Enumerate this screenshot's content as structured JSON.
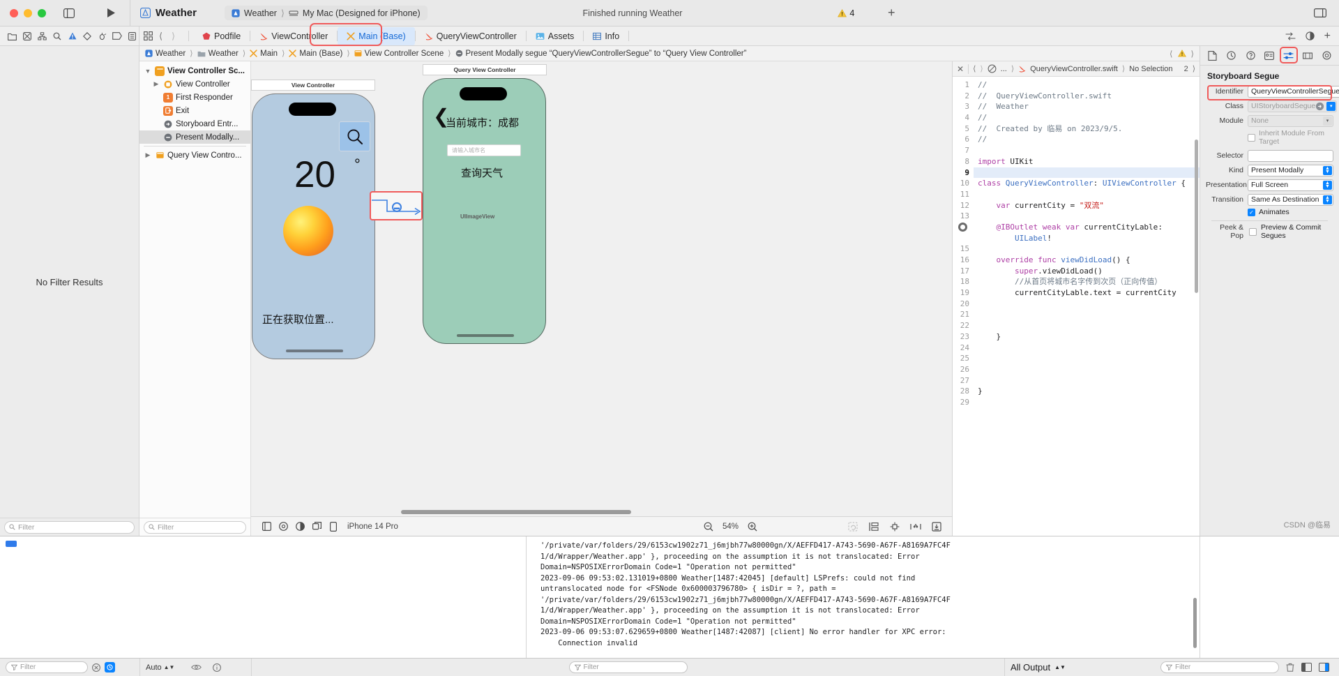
{
  "window": {
    "project_title": "Weather",
    "scheme_project": "Weather",
    "scheme_device": "My Mac (Designed for iPhone)",
    "status_message": "Finished running Weather",
    "warning_count": "4",
    "icons": {
      "sidebar_toggle": "sidebar-toggle-icon",
      "run": "run-icon",
      "add": "plus-icon",
      "layout": "layout-icon"
    }
  },
  "navigator_toolbar": {
    "icons": [
      "folder-icon",
      "source-control-icon",
      "symbol-icon",
      "find-icon",
      "issue-icon",
      "test-icon",
      "debug-icon",
      "breakpoint-icon",
      "report-icon"
    ]
  },
  "tabs": {
    "items": [
      {
        "label": "Podfile",
        "icon": "cocoapods-icon",
        "active": false
      },
      {
        "label": "ViewController",
        "icon": "swift-icon",
        "active": false
      },
      {
        "label": "Main (Base)",
        "icon": "storyboard-icon",
        "active": true
      },
      {
        "label": "QueryViewController",
        "icon": "swift-icon",
        "active": false
      },
      {
        "label": "Assets",
        "icon": "assets-icon",
        "active": false
      },
      {
        "label": "Info",
        "icon": "info-plist-icon",
        "active": false
      }
    ]
  },
  "jumpbar": {
    "crumbs": [
      {
        "label": "Weather",
        "icon": "project-icon"
      },
      {
        "label": "Weather",
        "icon": "folder-icon"
      },
      {
        "label": "Main",
        "icon": "storyboard-icon"
      },
      {
        "label": "Main (Base)",
        "icon": "storyboard-icon"
      },
      {
        "label": "View Controller Scene",
        "icon": "scene-icon"
      },
      {
        "label": "Present Modally segue “QueryViewControllerSegue” to “Query View Controller”",
        "icon": "segue-icon"
      }
    ],
    "warning_icon": "warning-icon"
  },
  "navigator": {
    "no_results_label": "No Filter Results",
    "filter_placeholder": "Filter"
  },
  "outline": {
    "items": [
      {
        "label": "View Controller Sc...",
        "indent": 0,
        "twisty": "down",
        "icon": "scene-icon",
        "bold": true,
        "selected": false
      },
      {
        "label": "View Controller",
        "indent": 1,
        "twisty": "right",
        "icon": "viewcontroller-icon",
        "bold": false,
        "selected": false
      },
      {
        "label": "First Responder",
        "indent": 1,
        "twisty": "",
        "icon": "first-responder-icon",
        "bold": false,
        "selected": false
      },
      {
        "label": "Exit",
        "indent": 1,
        "twisty": "",
        "icon": "exit-icon",
        "bold": false,
        "selected": false
      },
      {
        "label": "Storyboard Entr...",
        "indent": 1,
        "twisty": "",
        "icon": "entry-point-icon",
        "bold": false,
        "selected": false
      },
      {
        "label": "Present Modally...",
        "indent": 1,
        "twisty": "",
        "icon": "segue-icon",
        "bold": false,
        "selected": true
      },
      {
        "label": "Query View Contro...",
        "indent": 0,
        "twisty": "right",
        "icon": "scene-icon",
        "bold": false,
        "selected": false
      }
    ],
    "filter_placeholder": "Filter"
  },
  "canvas": {
    "scene1": {
      "title": "View Controller",
      "temperature": "20",
      "degree_symbol": "°",
      "location_status": "正在获取位置...",
      "search_icon": "search-icon",
      "sun_icon": "sun-icon"
    },
    "scene2": {
      "title": "Query View Controller",
      "back_icon": "back-chevron-icon",
      "city_label": "当前城市：成都",
      "textfield_placeholder": "请输入城市名",
      "query_button": "查询天气",
      "imageview_label": "UIImageView"
    },
    "segue_badge": "segue-icon",
    "bottom_bar": {
      "device": "iPhone 14 Pro",
      "zoom": "54%",
      "zoom_out_icon": "zoom-out-icon",
      "zoom_in_icon": "zoom-in-icon",
      "icons": [
        "view-as-icon",
        "preview-icon",
        "appearance-icon",
        "variants-icon",
        "device-icon",
        "update-frames-icon",
        "embed-icon",
        "align-icon",
        "add-constraints-icon",
        "resolve-issues-icon"
      ]
    }
  },
  "code": {
    "jumpbar": {
      "close_icon": "close-icon",
      "back_icon": "chevron-left-icon",
      "forward_icon": "chevron-right-icon",
      "related_icon": "related-items-icon",
      "ellipsis": "...",
      "file": "QueryViewController.swift",
      "selection": "No Selection",
      "counter": "2"
    },
    "lines": [
      {
        "n": 1,
        "tokens": [
          {
            "t": "//",
            "c": "cmt"
          }
        ]
      },
      {
        "n": 2,
        "tokens": [
          {
            "t": "//  QueryViewController.swift",
            "c": "cmt"
          }
        ]
      },
      {
        "n": 3,
        "tokens": [
          {
            "t": "//  Weather",
            "c": "cmt"
          }
        ]
      },
      {
        "n": 4,
        "tokens": [
          {
            "t": "//",
            "c": "cmt"
          }
        ]
      },
      {
        "n": 5,
        "tokens": [
          {
            "t": "//  Created by 临易 on 2023/9/5.",
            "c": "cmt"
          }
        ]
      },
      {
        "n": 6,
        "tokens": [
          {
            "t": "//",
            "c": "cmt"
          }
        ]
      },
      {
        "n": 7,
        "tokens": []
      },
      {
        "n": 8,
        "tokens": [
          {
            "t": "import ",
            "c": "kw"
          },
          {
            "t": "UIKit",
            "c": "plain"
          }
        ]
      },
      {
        "n": 9,
        "tokens": [],
        "current": true
      },
      {
        "n": 10,
        "tokens": [
          {
            "t": "class ",
            "c": "kw"
          },
          {
            "t": "QueryViewController",
            "c": "typ"
          },
          {
            "t": ": ",
            "c": "plain"
          },
          {
            "t": "UIViewController",
            "c": "typ"
          },
          {
            "t": " {",
            "c": "plain"
          }
        ]
      },
      {
        "n": 11,
        "tokens": []
      },
      {
        "n": 12,
        "tokens": [
          {
            "t": "    var ",
            "c": "kw"
          },
          {
            "t": "currentCity = ",
            "c": "plain"
          },
          {
            "t": "\"双流\"",
            "c": "str"
          }
        ]
      },
      {
        "n": 13,
        "tokens": []
      },
      {
        "n": 14,
        "tokens": [
          {
            "t": "    @IBOutlet ",
            "c": "attr"
          },
          {
            "t": "weak ",
            "c": "kw"
          },
          {
            "t": "var ",
            "c": "kw"
          },
          {
            "t": "currentCityLable",
            "c": "plain"
          },
          {
            "t": ":",
            "c": "plain"
          }
        ],
        "breakpoint": true
      },
      {
        "n": "",
        "tokens": [
          {
            "t": "        ",
            "c": "plain"
          },
          {
            "t": "UILabel",
            "c": "typ"
          },
          {
            "t": "!",
            "c": "plain"
          }
        ],
        "continuation": true
      },
      {
        "n": 15,
        "tokens": []
      },
      {
        "n": 16,
        "tokens": [
          {
            "t": "    override func ",
            "c": "kw"
          },
          {
            "t": "viewDidLoad",
            "c": "typ"
          },
          {
            "t": "() {",
            "c": "plain"
          }
        ]
      },
      {
        "n": 17,
        "tokens": [
          {
            "t": "        ",
            "c": "plain"
          },
          {
            "t": "super",
            "c": "kw"
          },
          {
            "t": ".viewDidLoad()",
            "c": "plain"
          }
        ]
      },
      {
        "n": 18,
        "tokens": [
          {
            "t": "        //从首页将城市名字传到次页（正向传值）",
            "c": "cmt"
          }
        ]
      },
      {
        "n": 19,
        "tokens": [
          {
            "t": "        currentCityLable.text = currentCity",
            "c": "plain"
          }
        ]
      },
      {
        "n": 20,
        "tokens": []
      },
      {
        "n": 21,
        "tokens": []
      },
      {
        "n": 22,
        "tokens": []
      },
      {
        "n": 23,
        "tokens": [
          {
            "t": "    }",
            "c": "plain"
          }
        ]
      },
      {
        "n": 24,
        "tokens": []
      },
      {
        "n": 25,
        "tokens": []
      },
      {
        "n": 26,
        "tokens": []
      },
      {
        "n": 27,
        "tokens": []
      },
      {
        "n": 28,
        "tokens": [
          {
            "t": "}",
            "c": "plain"
          }
        ]
      },
      {
        "n": 29,
        "tokens": []
      }
    ]
  },
  "inspector": {
    "tabs": [
      "file-inspector-icon",
      "history-inspector-icon",
      "quick-help-icon",
      "identity-inspector-icon",
      "attributes-inspector-icon",
      "size-inspector-icon",
      "connections-inspector-icon"
    ],
    "active_tab_index": 4,
    "title": "Storyboard Segue",
    "fields": [
      {
        "label": "Identifier",
        "value": "QueryViewControllerSegue",
        "type": "text",
        "disabled": false,
        "highlight": true
      },
      {
        "label": "Class",
        "value": "UIStoryboardSegue",
        "type": "combo",
        "disabled": true,
        "highlight": false
      },
      {
        "label": "Module",
        "value": "None",
        "type": "popup-plain",
        "disabled": true,
        "highlight": false
      }
    ],
    "inherit_module_label": "Inherit Module From Target",
    "inherit_module_checked": false,
    "selector_label": "Selector",
    "selector_value": "",
    "popups": [
      {
        "label": "Kind",
        "value": "Present Modally"
      },
      {
        "label": "Presentation",
        "value": "Full Screen"
      },
      {
        "label": "Transition",
        "value": "Same As Destination"
      }
    ],
    "animates_label": "Animates",
    "animates_checked": true,
    "peek_pop_label": "Peek & Pop",
    "preview_commit_label": "Preview & Commit Segues",
    "preview_commit_checked": false,
    "watermark": "CSDN @临易"
  },
  "console": {
    "text": "'/private/var/folders/29/6153cw1902z71_j6mjbh77w80000gn/X/AEFFD417-A743-5690-A67F-A8169A7FC4F\n1/d/Wrapper/Weather.app' }, proceeding on the assumption it is not translocated: Error\nDomain=NSPOSIXErrorDomain Code=1 \"Operation not permitted\"\n2023-09-06 09:53:02.131019+0800 Weather[1487:42045] [default] LSPrefs: could not find\nuntranslocated node for <FSNode 0x600003796780> { isDir = ?, path =\n'/private/var/folders/29/6153cw1902z71_j6mjbh77w80000gn/X/AEFFD417-A743-5690-A67F-A8169A7FC4F\n1/d/Wrapper/Weather.app' }, proceeding on the assumption it is not translocated: Error\nDomain=NSPOSIXErrorDomain Code=1 \"Operation not permitted\"\n2023-09-06 09:53:07.629659+0800 Weather[1487:42087] [client] No error handler for XPC error:\n    Connection invalid"
  },
  "statusbar": {
    "left_filter_placeholder": "Filter",
    "auto_label": "Auto",
    "debug_filter_placeholder": "Filter",
    "output_scope": "All Output",
    "console_filter_placeholder": "Filter",
    "trash_icon": "trash-icon"
  }
}
